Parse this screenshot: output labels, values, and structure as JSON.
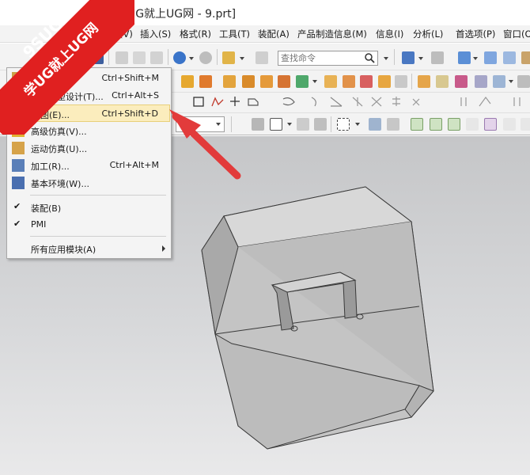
{
  "window": {
    "title": "- [学UG就上UG网 - 9.prt]"
  },
  "watermark": {
    "brand": "9SUG",
    "slogan": "学UG就上UG网",
    "color": "#e02020"
  },
  "menubar": {
    "items": [
      "视图(V)",
      "插入(S)",
      "格式(R)",
      "工具(T)",
      "装配(A)",
      "产品制造信息(M)",
      "信息(I)",
      "分析(L)",
      "首选项(P)",
      "窗口(O)"
    ]
  },
  "toolbar": {
    "search_placeholder": "查找命令"
  },
  "app_menu": {
    "items": [
      {
        "label": "建模(L)...",
        "shortcut": "Ctrl+Shift+M",
        "icon": "modeling-icon"
      },
      {
        "label": "外观造型设计(T)...",
        "shortcut": "Ctrl+Alt+S",
        "icon": "shape-studio-icon"
      },
      {
        "label": "制图(E)...",
        "shortcut": "Ctrl+Shift+D",
        "icon": "drafting-icon",
        "highlighted": true
      },
      {
        "label": "高级仿真(V)...",
        "shortcut": "",
        "icon": "advanced-simulation-icon"
      },
      {
        "label": "运动仿真(U)...",
        "shortcut": "",
        "icon": "motion-simulation-icon"
      },
      {
        "label": "加工(R)...",
        "shortcut": "Ctrl+Alt+M",
        "icon": "manufacturing-icon"
      },
      {
        "label": "基本环境(W)...",
        "shortcut": "",
        "icon": "gateway-icon"
      }
    ],
    "checked": [
      {
        "label": "装配(B)",
        "checked": true
      },
      {
        "label": "PMI",
        "checked": true
      }
    ],
    "submenu": {
      "label": "所有应用模块(A)"
    }
  },
  "colors": {
    "highlight": "#fbedbd",
    "arrow": "#e23b3b",
    "model_face": "#b9b9b9"
  }
}
